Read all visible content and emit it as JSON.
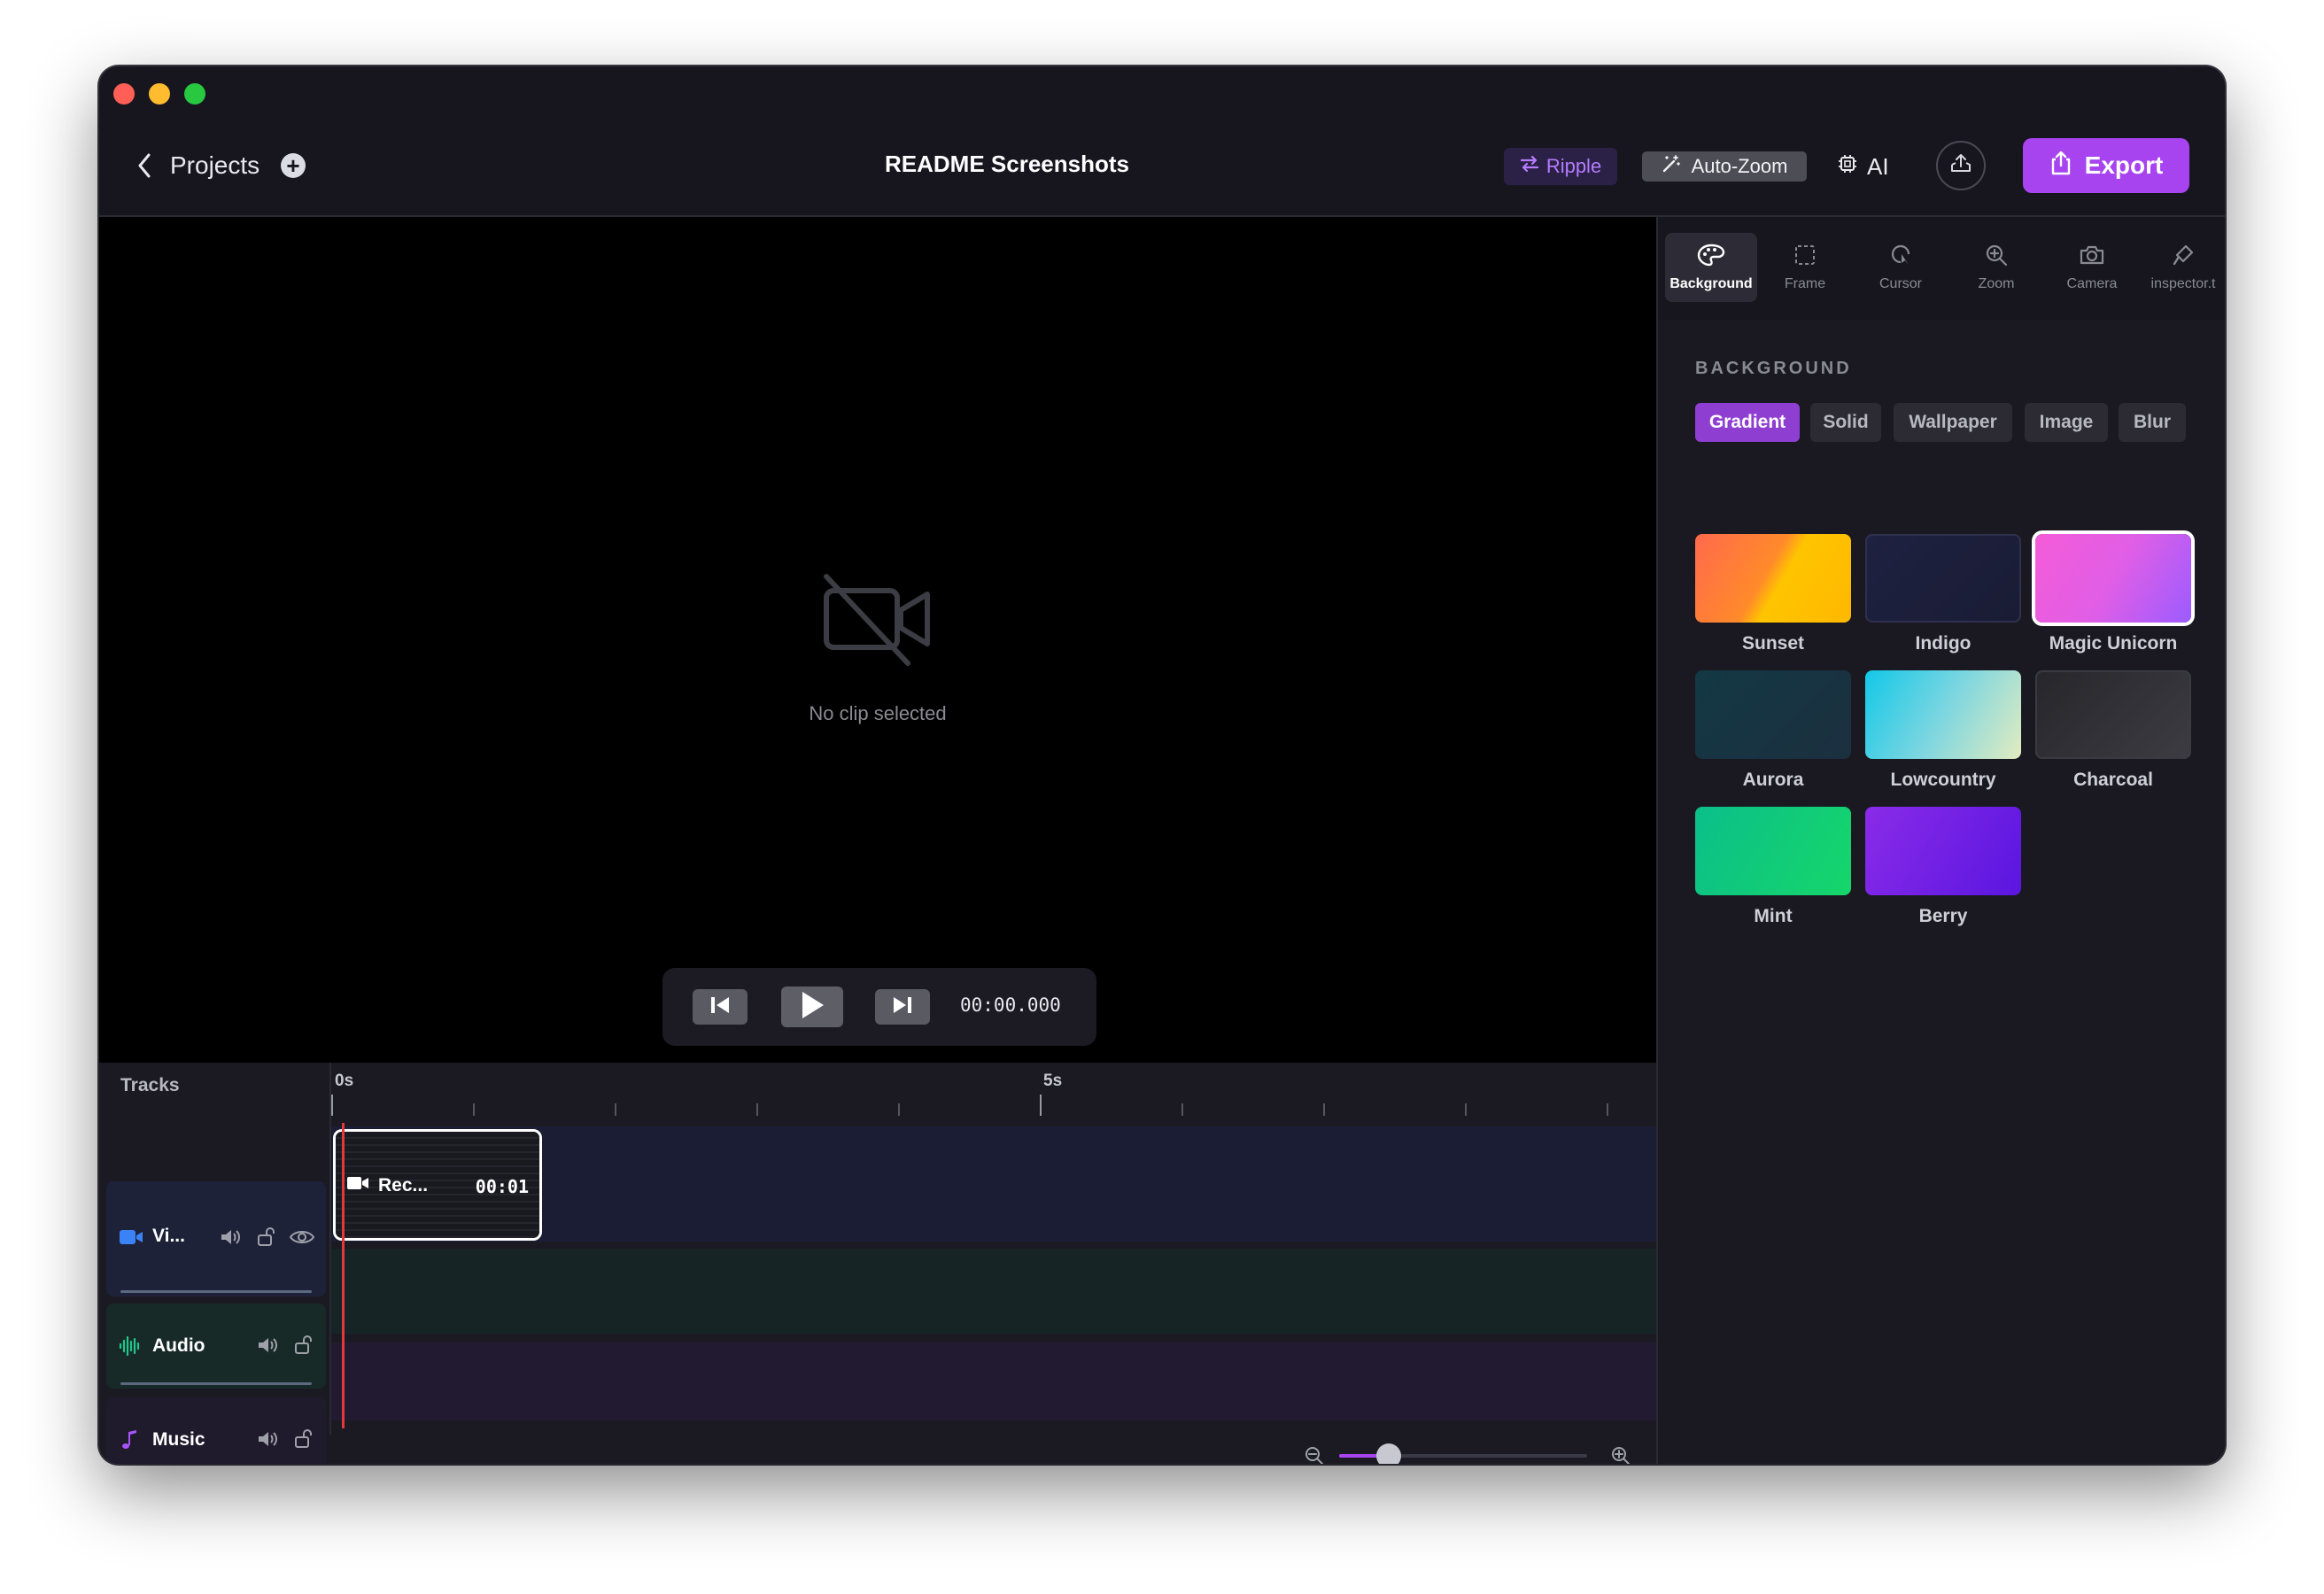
{
  "window": {
    "back_label": "Projects",
    "document_title": "README Screenshots"
  },
  "toolbar": {
    "ripple_label": "Ripple",
    "autozoom_label": "Auto-Zoom",
    "ai_label": "AI",
    "export_label": "Export"
  },
  "preview": {
    "empty_text": "No clip selected",
    "timecode": "00:00.000"
  },
  "inspector": {
    "tabs": [
      {
        "label": "Background",
        "icon": "palette-icon"
      },
      {
        "label": "Frame",
        "icon": "frame-icon"
      },
      {
        "label": "Cursor",
        "icon": "cursor-icon"
      },
      {
        "label": "Zoom",
        "icon": "zoom-icon"
      },
      {
        "label": "Camera",
        "icon": "camera-icon"
      },
      {
        "label": "inspector.t",
        "icon": "brush-icon"
      }
    ],
    "section_title": "BACKGROUND",
    "segments": [
      "Gradient",
      "Solid",
      "Wallpaper",
      "Image",
      "Blur"
    ],
    "swatches": [
      {
        "label": "Sunset",
        "colors": [
          "#ff6a4d",
          "#ffb800"
        ]
      },
      {
        "label": "Indigo",
        "colors": [
          "#1e2140",
          "#1a1c35"
        ]
      },
      {
        "label": "Magic Unicorn",
        "colors": [
          "#f45cd8",
          "#9b5cff"
        ]
      },
      {
        "label": "Aurora",
        "colors": [
          "#133844",
          "#1c2f3f"
        ]
      },
      {
        "label": "Lowcountry",
        "colors": [
          "#12c8e8",
          "#e2ecc0"
        ]
      },
      {
        "label": "Charcoal",
        "colors": [
          "#2c2c31",
          "#3c3c42"
        ]
      },
      {
        "label": "Mint",
        "colors": [
          "#0bbf8a",
          "#16d66a"
        ]
      },
      {
        "label": "Berry",
        "colors": [
          "#8a2be8",
          "#5a16e0"
        ]
      }
    ]
  },
  "timeline": {
    "tracks_label": "Tracks",
    "ruler_labels": [
      "0s",
      "5s"
    ],
    "tracks": [
      {
        "name": "Vi...",
        "color": "#3b82f6"
      },
      {
        "name": "Audio",
        "color": "#22c58a"
      },
      {
        "name": "Music",
        "color": "#a855f7"
      }
    ],
    "clip": {
      "label": "Rec...",
      "duration": "00:01"
    },
    "zoom_level": 0.2
  },
  "colors": {
    "accent": "#a744f0",
    "playhead": "#e23a3a"
  }
}
